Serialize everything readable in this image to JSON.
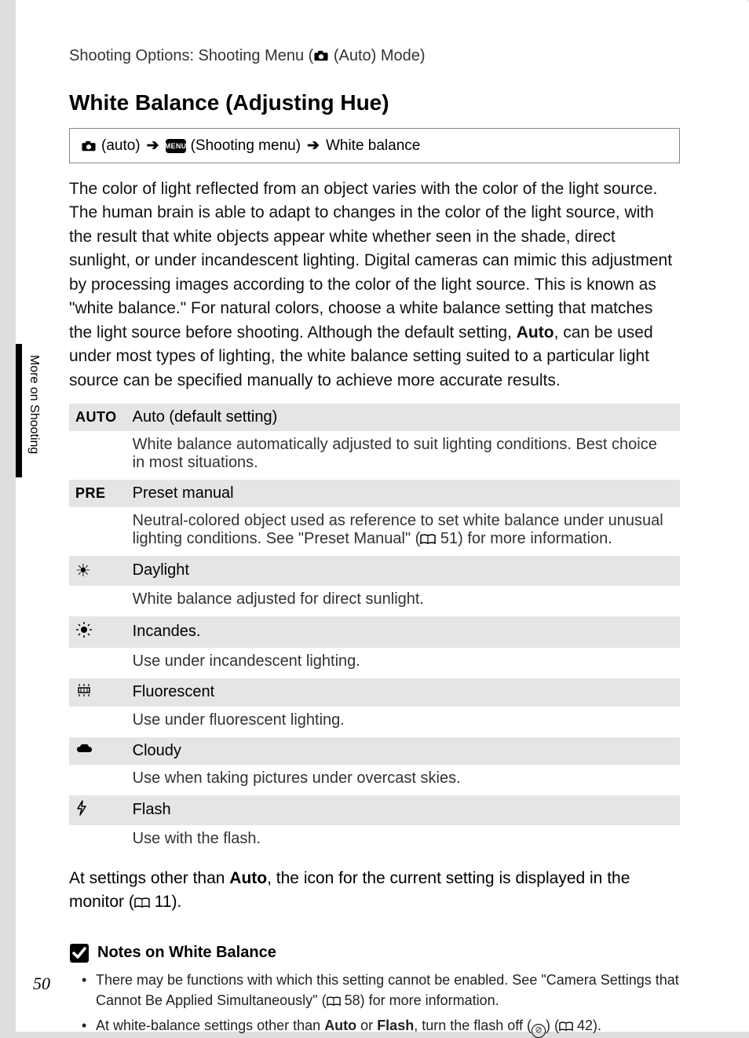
{
  "breadcrumb": {
    "prefix": "Shooting Options: Shooting Menu (",
    "mode": " (Auto) Mode)"
  },
  "title": "White Balance (Adjusting Hue)",
  "path": {
    "p1": " (auto) ",
    "p2": " (Shooting menu) ",
    "p3": " White balance",
    "menu_label": "MENU"
  },
  "intro": {
    "t1": "The color of light reflected from an object varies with the color of the light source. The human brain is able to adapt to changes in the color of the light source, with the result that white objects appear white whether seen in the shade, direct sunlight, or under incandescent lighting. Digital cameras can mimic this adjustment by processing images according to the color of the light source. This is known as \"white balance.\" For natural colors, choose a white balance setting that matches the light source before shooting. Although the default setting, ",
    "bold1": "Auto",
    "t2": ", can be used under most types of lighting, the white balance setting suited to a particular light source can be specified manually to achieve more accurate results."
  },
  "options": [
    {
      "icon_text": "AUTO",
      "label": "Auto (default setting)",
      "desc": "White balance automatically adjusted to suit lighting conditions. Best choice in most situations."
    },
    {
      "icon_text": "PRE",
      "label": "Preset manual",
      "desc_a": "Neutral-colored object used as reference to set white balance under unusual lighting conditions. See \"Preset Manual\" (",
      "desc_ref": " 51",
      "desc_b": ") for more information."
    },
    {
      "icon_glyph": "☀",
      "label": "Daylight",
      "desc": "White balance adjusted for direct sunlight."
    },
    {
      "icon_glyph": "♨",
      "label": "Incandes.",
      "desc": "Use under incandescent lighting."
    },
    {
      "icon_glyph": "▥",
      "label": "Fluorescent",
      "desc": "Use under fluorescent lighting."
    },
    {
      "icon_glyph": "☁",
      "label": "Cloudy",
      "desc": "Use when taking pictures under overcast skies."
    },
    {
      "icon_glyph": "⚡",
      "label": "Flash",
      "desc": "Use with the flash."
    }
  ],
  "footer": {
    "t1": "At settings other than ",
    "bold1": "Auto",
    "t2": ", the icon for the current setting is displayed in the monitor (",
    "ref": " 11",
    "t3": ")."
  },
  "notes": {
    "title": "Notes on White Balance",
    "items": [
      {
        "a": "There may be functions with which this setting cannot be enabled. See \"Camera Settings that Cannot Be Applied Simultaneously\" (",
        "ref": " 58",
        "b": ") for more information."
      },
      {
        "a": "At white-balance settings other than ",
        "bold1": "Auto",
        "mid": " or ",
        "bold2": "Flash",
        "b": ", turn the flash off (",
        "c": ") (",
        "ref": " 42",
        "d": ")."
      }
    ]
  },
  "side_tab": "More on Shooting",
  "page_number": "50"
}
